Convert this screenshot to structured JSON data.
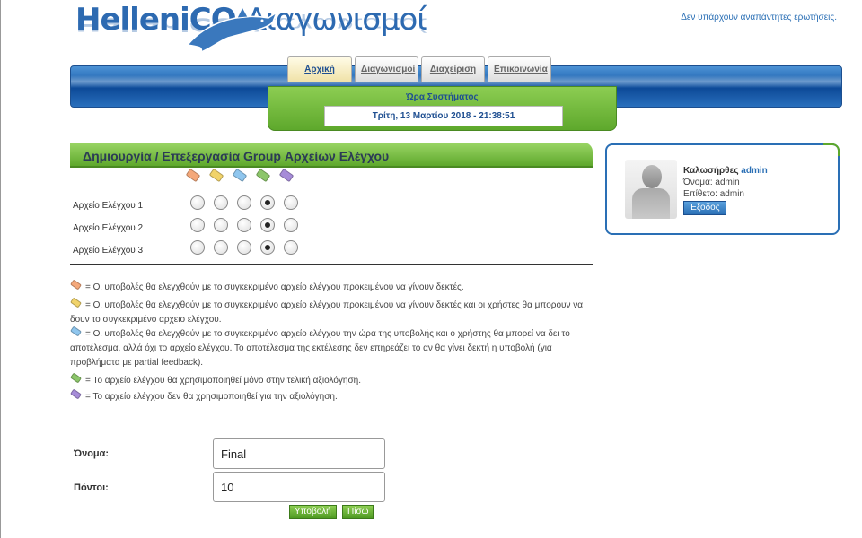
{
  "logo": {
    "part1": "HelleniCO",
    "part2": "Διαγωνισμοί"
  },
  "notice": "Δεν υπάρχουν αναπάντητες ερωτήσεις.",
  "nav": {
    "tabs": [
      "Αρχική",
      "Διαγωνισμοί",
      "Διαχείριση",
      "Επικοινωνία"
    ],
    "active": "Αρχική"
  },
  "clock": {
    "label": "Ώρα Συστήματος",
    "value": "Τρίτη, 13 Μαρτίου 2018 - 21:38:51"
  },
  "panel": {
    "title": "Δημιουργία / Επεξεργασία Group Αρχείων Ελέγχου"
  },
  "tag_colors": [
    "#f4a87a",
    "#f1d36a",
    "#8fc6ee",
    "#8cc66a",
    "#a68cd8"
  ],
  "files": [
    {
      "label": "Αρχείο Ελέγχου 1",
      "selected_index": 3
    },
    {
      "label": "Αρχείο Ελέγχου 2",
      "selected_index": 3
    },
    {
      "label": "Αρχείο Ελέγχου 3",
      "selected_index": 3
    }
  ],
  "legend": [
    "= Οι υποβολές θα ελεγχθούν με το συγκεκριμένο αρχείο ελέγχου προκειμένου να γίνουν δεκτές.",
    "= Οι υποβολές θα ελεγχθούν με το συγκεκριμένο αρχείο ελέγχου προκειμένου να γίνουν δεκτές και οι χρήστες θα μπορουν να δουν το συγκεκριμένο αρχειο ελέγχου.",
    "= Οι υποβολές θα ελεγχθούν με το συγκεκριμένο αρχείο ελέγχου την ώρα της υποβολής και ο χρήστης θα μπορεί να δει το αποτέλεσμα, αλλά όχι το αρχείο ελέγχου. Το αποτέλεσμα της εκτέλεσης δεν επηρεάζει το αν θα γίνει δεκτή η υποβολή (για προβλήματα με partial feedback).",
    "= Το αρχείο ελέγχου θα χρησιμοποιηθεί μόνο στην τελική αξιολόγηση.",
    "= Το αρχείο ελέγχου δεν θα χρησιμοποιηθεί για την αξιολόγηση."
  ],
  "form": {
    "name_label": "Όνομα:",
    "name_value": "Final",
    "points_label": "Πόντοι:",
    "points_value": "10",
    "submit_label": "Υποβολή",
    "back_label": "Πίσω"
  },
  "user": {
    "welcome": "Καλωσήρθες",
    "username": "admin",
    "first_name_line": "Όνομα: admin",
    "last_name_line": "Επίθετο: admin",
    "logout_label": "Έξοδος"
  }
}
